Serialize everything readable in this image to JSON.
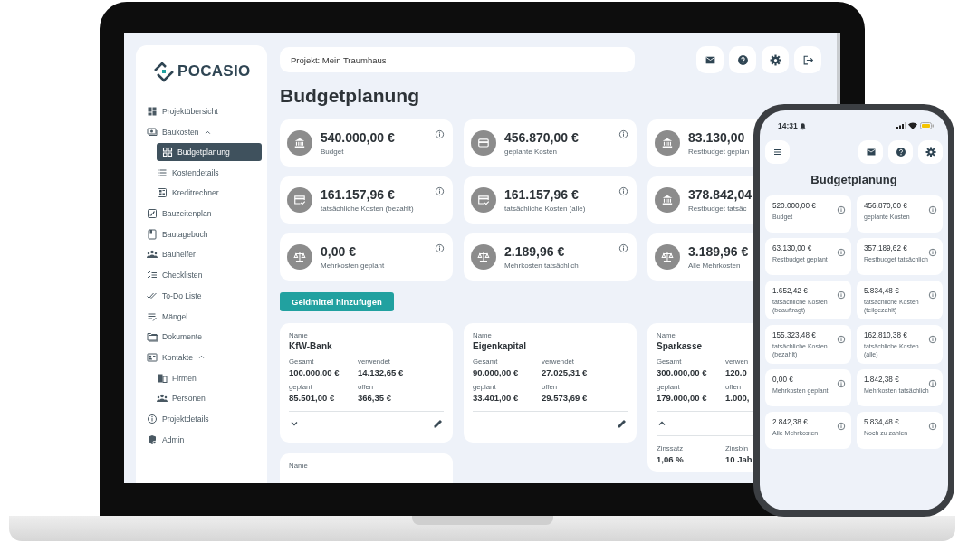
{
  "sidebar": {
    "logo": "POCASIO",
    "items": [
      {
        "label": "Projektübersicht",
        "selected": false
      },
      {
        "label": "Baukosten",
        "selected": false,
        "expanded": true,
        "children": [
          {
            "label": "Budgetplanung",
            "selected": true
          },
          {
            "label": "Kostendetails",
            "selected": false
          },
          {
            "label": "Kreditrechner",
            "selected": false
          }
        ]
      },
      {
        "label": "Bauzeitenplan",
        "selected": false
      },
      {
        "label": "Bautagebuch",
        "selected": false
      },
      {
        "label": "Bauhelfer",
        "selected": false
      },
      {
        "label": "Checklisten",
        "selected": false
      },
      {
        "label": "To-Do Liste",
        "selected": false
      },
      {
        "label": "Mängel",
        "selected": false
      },
      {
        "label": "Dokumente",
        "selected": false
      },
      {
        "label": "Kontakte",
        "selected": false,
        "expanded": true,
        "children": [
          {
            "label": "Firmen",
            "selected": false
          },
          {
            "label": "Personen",
            "selected": false
          }
        ]
      },
      {
        "label": "Projektdetails",
        "selected": false
      },
      {
        "label": "Admin",
        "selected": false
      }
    ]
  },
  "project_field": {
    "value": "Projekt: Mein Traumhaus"
  },
  "page_title": "Budgetplanung",
  "stat_cards": [
    {
      "value": "540.000,00 €",
      "label": "Budget"
    },
    {
      "value": "456.870,00 €",
      "label": "geplante Kosten"
    },
    {
      "value": "83.130,00",
      "label": "Restbudget geplan"
    },
    {
      "value": "161.157,96 €",
      "label": "tatsächliche Kosten (bezahlt)"
    },
    {
      "value": "161.157,96 €",
      "label": "tatsächliche Kosten (alle)"
    },
    {
      "value": "378.842,04",
      "label": "Restbudget tatsäc"
    },
    {
      "value": "0,00 €",
      "label": "Mehrkosten geplant"
    },
    {
      "value": "2.189,96 €",
      "label": "Mehrkosten tatsächlich"
    },
    {
      "value": "3.189,96 €",
      "label": "Alle Mehrkosten"
    }
  ],
  "add_button": "Geldmittel hinzufügen",
  "fund_cards": [
    {
      "name_label": "Name",
      "name": "KfW-Bank",
      "expanded": false,
      "fields": [
        {
          "label": "Gesamt",
          "value": "100.000,00 €"
        },
        {
          "label": "verwendet",
          "value": "14.132,65 €"
        },
        {
          "label": "geplant",
          "value": "85.501,00 €"
        },
        {
          "label": "offen",
          "value": "366,35 €"
        }
      ]
    },
    {
      "name_label": "Name",
      "name": "Eigenkapital",
      "fields": [
        {
          "label": "Gesamt",
          "value": "90.000,00 €"
        },
        {
          "label": "verwendet",
          "value": "27.025,31 €"
        },
        {
          "label": "geplant",
          "value": "33.401,00 €"
        },
        {
          "label": "offen",
          "value": "29.573,69 €"
        }
      ]
    },
    {
      "name_label": "Name",
      "name": "Sparkasse",
      "expanded": true,
      "fields": [
        {
          "label": "Gesamt",
          "value": "300.000,00 €"
        },
        {
          "label": "verwen",
          "value": "120.0"
        },
        {
          "label": "geplant",
          "value": "179.000,00 €"
        },
        {
          "label": "offen",
          "value": "1.000,"
        }
      ],
      "details": [
        {
          "label": "Zinssatz",
          "value": "1,06 %"
        },
        {
          "label": "Zinsbin",
          "value": "10 Jah"
        }
      ]
    },
    {
      "name_label": "Name"
    }
  ],
  "phone": {
    "time": "14:31",
    "title": "Budgetplanung",
    "stat_cards": [
      {
        "value": "520.000,00 €",
        "label": "Budget"
      },
      {
        "value": "456.870,00 €",
        "label": "geplante Kosten"
      },
      {
        "value": "63.130,00 €",
        "label": "Restbudget geplant"
      },
      {
        "value": "357.189,62 €",
        "label": "Restbudget tatsächlich"
      },
      {
        "value": "1.652,42 €",
        "label": "tatsächliche Kosten (beauftragt)"
      },
      {
        "value": "5.834,48 €",
        "label": "tatsächliche Kosten (teilgezahlt)"
      },
      {
        "value": "155.323,48 €",
        "label": "tatsächliche Kosten (bezahlt)"
      },
      {
        "value": "162.810,38 €",
        "label": "tatsächliche Kosten (alle)"
      },
      {
        "value": "0,00 €",
        "label": "Mehrkosten geplant"
      },
      {
        "value": "1.842,38 €",
        "label": "Mehrkosten tatsächlich"
      },
      {
        "value": "2.842,38 €",
        "label": "Alle Mehrkosten"
      },
      {
        "value": "5.834,48 €",
        "label": "Noch zu zahlen"
      }
    ]
  }
}
